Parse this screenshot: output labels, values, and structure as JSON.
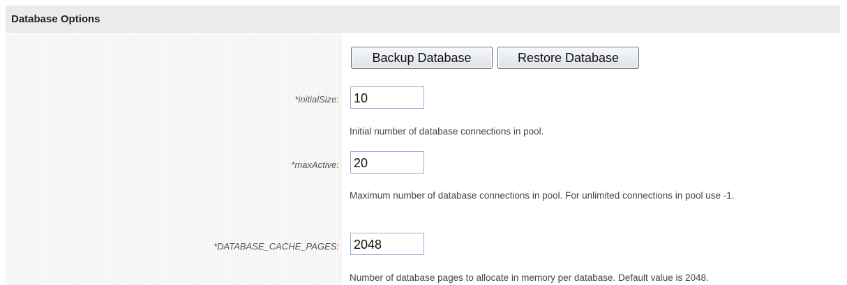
{
  "panel": {
    "title": "Database Options"
  },
  "buttons": {
    "backup_label": "Backup Database",
    "restore_label": "Restore Database"
  },
  "fields": {
    "initial_size": {
      "label": "*initialSize:",
      "value": "10",
      "help": "Initial number of database connections in pool."
    },
    "max_active": {
      "label": "*maxActive:",
      "value": "20",
      "help": "Maximum number of database connections in pool. For unlimited connections in pool use -1."
    },
    "database_cache_pages": {
      "label": "*DATABASE_CACHE_PAGES:",
      "value": "2048",
      "help": "Number of database pages to allocate in memory per database. Default value is 2048."
    }
  },
  "colors": {
    "header_bg": "#ebebeb",
    "input_border": "#8ab0d6",
    "button_border": "#606770"
  }
}
